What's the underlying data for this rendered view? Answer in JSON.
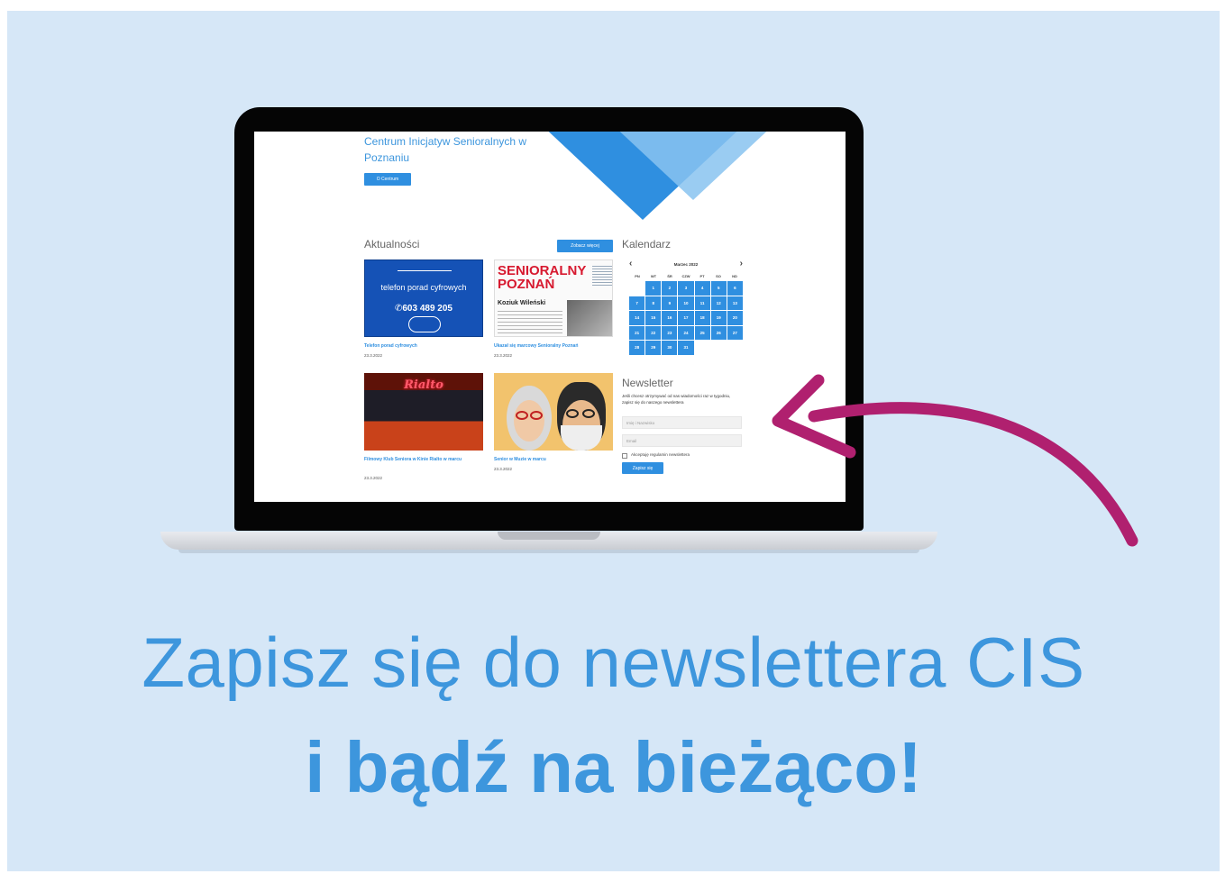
{
  "colors": {
    "background": "#d6e7f7",
    "accent": "#2f8fe0",
    "headline": "#3d96dd",
    "arrow": "#b0206f"
  },
  "site": {
    "title": "Centrum Inicjatyw Senioralnych w Poznaniu",
    "about_button": "O Centrum"
  },
  "news": {
    "heading": "Aktualności",
    "see_more_button": "Zobacz więcej",
    "items": [
      {
        "title": "Telefon porad cyfrowych",
        "date": "23.3.2022",
        "image_text": "telefon porad cyfrowych",
        "image_number": "603 489 205"
      },
      {
        "title": "Ukazał się marcowy Senioralny Poznań",
        "date": "23.3.2022",
        "image_title": "SENIORALNY POZNAŃ",
        "image_subtitle": "Koziuk Wileński"
      },
      {
        "title": "Filmowy Klub Seniora w Kinie Rialto w marcu",
        "date": "23.3.2022",
        "image_text": "Rialto"
      },
      {
        "title": "Senior w Muzie w marcu",
        "date": "23.3.2022"
      }
    ]
  },
  "calendar": {
    "heading": "Kalendarz",
    "month": "Marzec 2022",
    "weekdays": [
      "PN",
      "WT",
      "ŚR",
      "CZW",
      "PT",
      "SO",
      "ND"
    ],
    "days": [
      "1",
      "2",
      "3",
      "4",
      "5",
      "6",
      "7",
      "8",
      "9",
      "10",
      "11",
      "12",
      "13",
      "14",
      "15",
      "16",
      "17",
      "18",
      "19",
      "20",
      "21",
      "22",
      "23",
      "24",
      "25",
      "26",
      "27",
      "28",
      "29",
      "30",
      "31"
    ],
    "first_weekday_offset": 1,
    "prev_icon": "chevron-left-icon",
    "next_icon": "chevron-right-icon"
  },
  "newsletter": {
    "heading": "Newsletter",
    "description": "Jeśli chcesz otrzymywać od nas wiadomości raz w tygodniu, zapisz się do naszego newslettera",
    "name_placeholder": "Imię i Nazwisko",
    "email_placeholder": "Email",
    "consent_label": "Akceptuję regulamin newslettera",
    "submit_button": "Zapisz się"
  },
  "headline": {
    "line1": "Zapisz się do newslettera CIS",
    "line2": "i bądź na bieżąco!"
  }
}
